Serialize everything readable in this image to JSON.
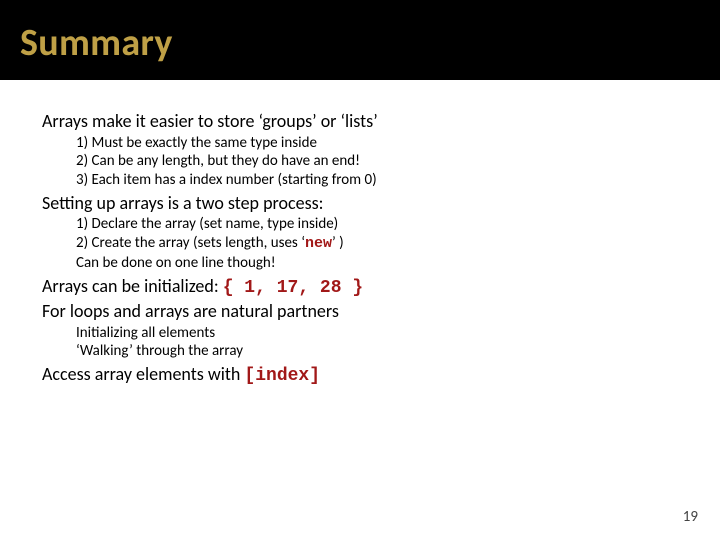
{
  "title": "Summary",
  "p1": "Arrays make it easier to store ‘groups’ or ‘lists’",
  "p1_subs": {
    "a": "1)  Must be exactly the same type inside",
    "b": "2)  Can be any length, but they do have an end!",
    "c": "3)  Each item has a index number (starting from 0)"
  },
  "p2": "Setting up arrays is a two step process:",
  "p2_subs": {
    "a": "1)  Declare the array (set name, type inside)",
    "b_pre": "2)  Create the array (sets length, uses ‘",
    "b_code": "new",
    "b_post": "’ )",
    "c": "Can be done on one line though!"
  },
  "p3_pre": "Arrays can be initialized: ",
  "p3_code": "{ 1, 17, 28 }",
  "p4": "For loops and arrays are natural partners",
  "p4_subs": {
    "a": "Initializing all elements",
    "b": "‘Walking’ through the array"
  },
  "p5_pre": "Access array elements with ",
  "p5_code": "[index]",
  "page_number": "19"
}
